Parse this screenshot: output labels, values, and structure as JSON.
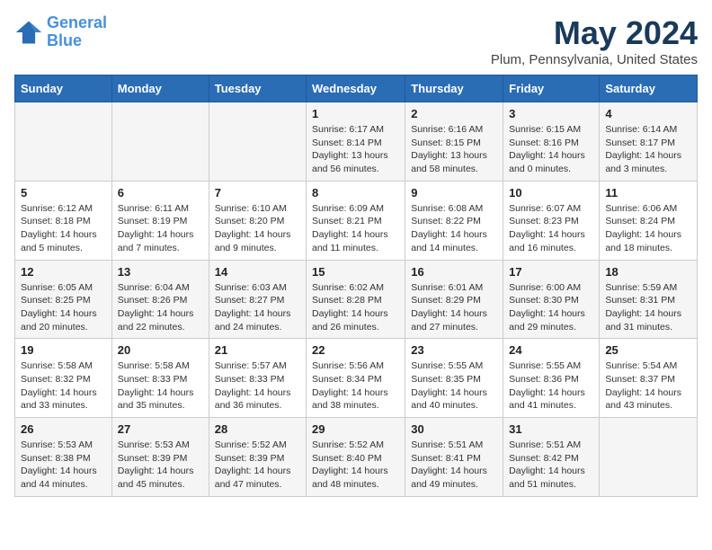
{
  "header": {
    "logo_line1": "General",
    "logo_line2": "Blue",
    "month_title": "May 2024",
    "location": "Plum, Pennsylvania, United States"
  },
  "days_of_week": [
    "Sunday",
    "Monday",
    "Tuesday",
    "Wednesday",
    "Thursday",
    "Friday",
    "Saturday"
  ],
  "weeks": [
    [
      {
        "day": "",
        "sunrise": "",
        "sunset": "",
        "daylight": ""
      },
      {
        "day": "",
        "sunrise": "",
        "sunset": "",
        "daylight": ""
      },
      {
        "day": "",
        "sunrise": "",
        "sunset": "",
        "daylight": ""
      },
      {
        "day": "1",
        "sunrise": "Sunrise: 6:17 AM",
        "sunset": "Sunset: 8:14 PM",
        "daylight": "Daylight: 13 hours and 56 minutes."
      },
      {
        "day": "2",
        "sunrise": "Sunrise: 6:16 AM",
        "sunset": "Sunset: 8:15 PM",
        "daylight": "Daylight: 13 hours and 58 minutes."
      },
      {
        "day": "3",
        "sunrise": "Sunrise: 6:15 AM",
        "sunset": "Sunset: 8:16 PM",
        "daylight": "Daylight: 14 hours and 0 minutes."
      },
      {
        "day": "4",
        "sunrise": "Sunrise: 6:14 AM",
        "sunset": "Sunset: 8:17 PM",
        "daylight": "Daylight: 14 hours and 3 minutes."
      }
    ],
    [
      {
        "day": "5",
        "sunrise": "Sunrise: 6:12 AM",
        "sunset": "Sunset: 8:18 PM",
        "daylight": "Daylight: 14 hours and 5 minutes."
      },
      {
        "day": "6",
        "sunrise": "Sunrise: 6:11 AM",
        "sunset": "Sunset: 8:19 PM",
        "daylight": "Daylight: 14 hours and 7 minutes."
      },
      {
        "day": "7",
        "sunrise": "Sunrise: 6:10 AM",
        "sunset": "Sunset: 8:20 PM",
        "daylight": "Daylight: 14 hours and 9 minutes."
      },
      {
        "day": "8",
        "sunrise": "Sunrise: 6:09 AM",
        "sunset": "Sunset: 8:21 PM",
        "daylight": "Daylight: 14 hours and 11 minutes."
      },
      {
        "day": "9",
        "sunrise": "Sunrise: 6:08 AM",
        "sunset": "Sunset: 8:22 PM",
        "daylight": "Daylight: 14 hours and 14 minutes."
      },
      {
        "day": "10",
        "sunrise": "Sunrise: 6:07 AM",
        "sunset": "Sunset: 8:23 PM",
        "daylight": "Daylight: 14 hours and 16 minutes."
      },
      {
        "day": "11",
        "sunrise": "Sunrise: 6:06 AM",
        "sunset": "Sunset: 8:24 PM",
        "daylight": "Daylight: 14 hours and 18 minutes."
      }
    ],
    [
      {
        "day": "12",
        "sunrise": "Sunrise: 6:05 AM",
        "sunset": "Sunset: 8:25 PM",
        "daylight": "Daylight: 14 hours and 20 minutes."
      },
      {
        "day": "13",
        "sunrise": "Sunrise: 6:04 AM",
        "sunset": "Sunset: 8:26 PM",
        "daylight": "Daylight: 14 hours and 22 minutes."
      },
      {
        "day": "14",
        "sunrise": "Sunrise: 6:03 AM",
        "sunset": "Sunset: 8:27 PM",
        "daylight": "Daylight: 14 hours and 24 minutes."
      },
      {
        "day": "15",
        "sunrise": "Sunrise: 6:02 AM",
        "sunset": "Sunset: 8:28 PM",
        "daylight": "Daylight: 14 hours and 26 minutes."
      },
      {
        "day": "16",
        "sunrise": "Sunrise: 6:01 AM",
        "sunset": "Sunset: 8:29 PM",
        "daylight": "Daylight: 14 hours and 27 minutes."
      },
      {
        "day": "17",
        "sunrise": "Sunrise: 6:00 AM",
        "sunset": "Sunset: 8:30 PM",
        "daylight": "Daylight: 14 hours and 29 minutes."
      },
      {
        "day": "18",
        "sunrise": "Sunrise: 5:59 AM",
        "sunset": "Sunset: 8:31 PM",
        "daylight": "Daylight: 14 hours and 31 minutes."
      }
    ],
    [
      {
        "day": "19",
        "sunrise": "Sunrise: 5:58 AM",
        "sunset": "Sunset: 8:32 PM",
        "daylight": "Daylight: 14 hours and 33 minutes."
      },
      {
        "day": "20",
        "sunrise": "Sunrise: 5:58 AM",
        "sunset": "Sunset: 8:33 PM",
        "daylight": "Daylight: 14 hours and 35 minutes."
      },
      {
        "day": "21",
        "sunrise": "Sunrise: 5:57 AM",
        "sunset": "Sunset: 8:33 PM",
        "daylight": "Daylight: 14 hours and 36 minutes."
      },
      {
        "day": "22",
        "sunrise": "Sunrise: 5:56 AM",
        "sunset": "Sunset: 8:34 PM",
        "daylight": "Daylight: 14 hours and 38 minutes."
      },
      {
        "day": "23",
        "sunrise": "Sunrise: 5:55 AM",
        "sunset": "Sunset: 8:35 PM",
        "daylight": "Daylight: 14 hours and 40 minutes."
      },
      {
        "day": "24",
        "sunrise": "Sunrise: 5:55 AM",
        "sunset": "Sunset: 8:36 PM",
        "daylight": "Daylight: 14 hours and 41 minutes."
      },
      {
        "day": "25",
        "sunrise": "Sunrise: 5:54 AM",
        "sunset": "Sunset: 8:37 PM",
        "daylight": "Daylight: 14 hours and 43 minutes."
      }
    ],
    [
      {
        "day": "26",
        "sunrise": "Sunrise: 5:53 AM",
        "sunset": "Sunset: 8:38 PM",
        "daylight": "Daylight: 14 hours and 44 minutes."
      },
      {
        "day": "27",
        "sunrise": "Sunrise: 5:53 AM",
        "sunset": "Sunset: 8:39 PM",
        "daylight": "Daylight: 14 hours and 45 minutes."
      },
      {
        "day": "28",
        "sunrise": "Sunrise: 5:52 AM",
        "sunset": "Sunset: 8:39 PM",
        "daylight": "Daylight: 14 hours and 47 minutes."
      },
      {
        "day": "29",
        "sunrise": "Sunrise: 5:52 AM",
        "sunset": "Sunset: 8:40 PM",
        "daylight": "Daylight: 14 hours and 48 minutes."
      },
      {
        "day": "30",
        "sunrise": "Sunrise: 5:51 AM",
        "sunset": "Sunset: 8:41 PM",
        "daylight": "Daylight: 14 hours and 49 minutes."
      },
      {
        "day": "31",
        "sunrise": "Sunrise: 5:51 AM",
        "sunset": "Sunset: 8:42 PM",
        "daylight": "Daylight: 14 hours and 51 minutes."
      },
      {
        "day": "",
        "sunrise": "",
        "sunset": "",
        "daylight": ""
      }
    ]
  ]
}
